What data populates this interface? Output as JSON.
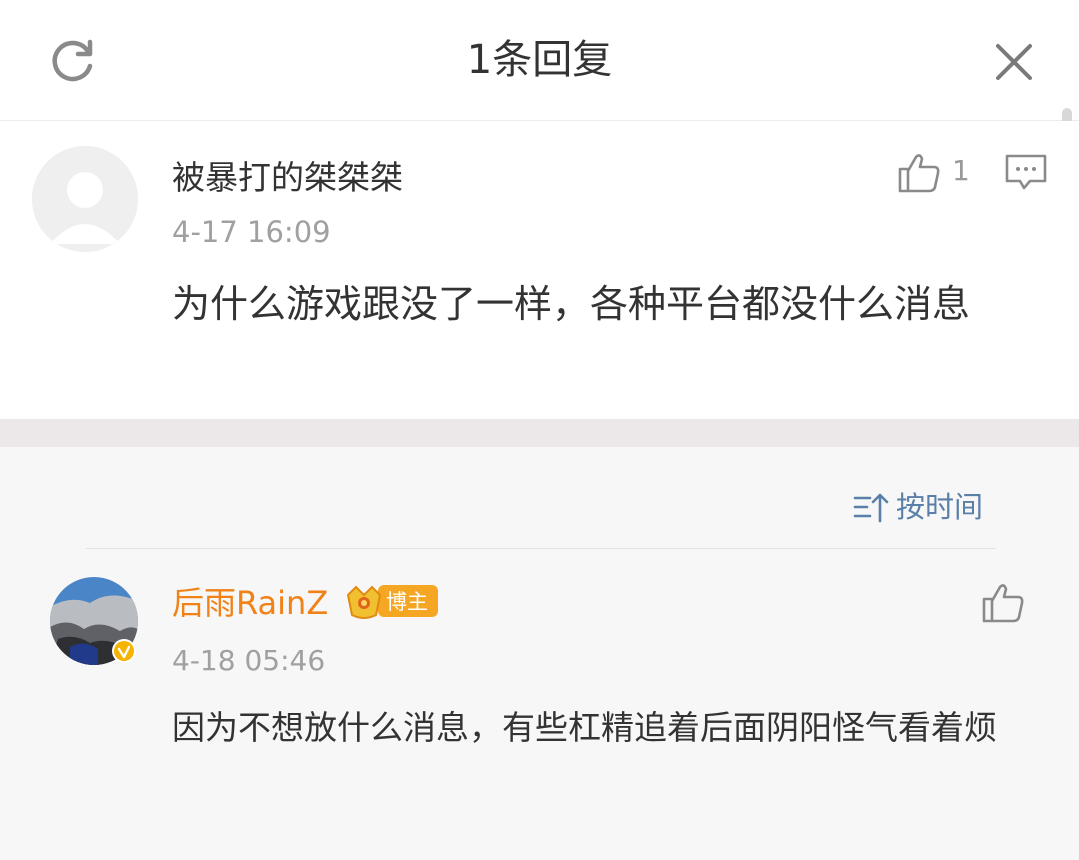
{
  "header": {
    "title": "1条回复",
    "refresh_icon": "refresh-icon",
    "close_icon": "close-icon"
  },
  "main_comment": {
    "username": "被暴打的桀桀桀",
    "timestamp": "4-17 16:09",
    "like_count": "1",
    "text": "为什么游戏跟没了一样，各种平台都没什么消息"
  },
  "replies": {
    "sort_label": "按时间",
    "items": [
      {
        "username": "后雨RainZ",
        "badge": "博主",
        "timestamp": "4-18 05:46",
        "text": "因为不想放什么消息，有些杠精追着后面阴阳怪气看着烦"
      }
    ]
  },
  "colors": {
    "username_highlight": "#f08218",
    "sort_blue": "#5a7fa8",
    "badge_orange": "#f5a623",
    "verified_gold": "#f4b400"
  }
}
